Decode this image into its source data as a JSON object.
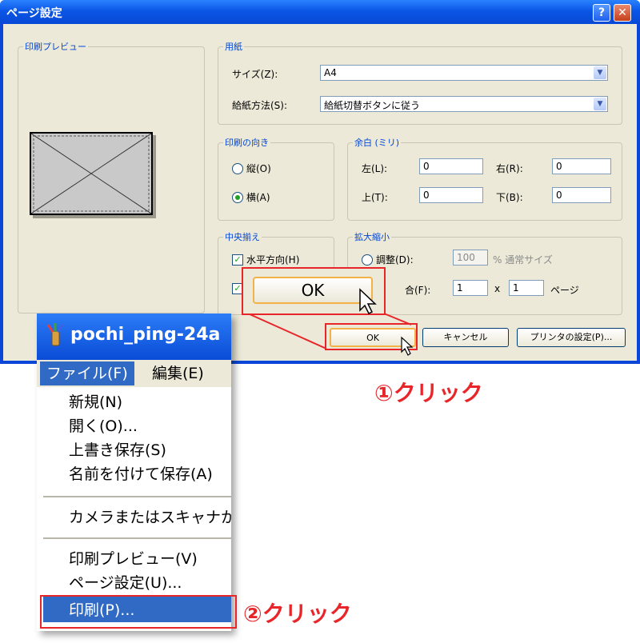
{
  "dialog": {
    "title": "ページ設定",
    "help_label": "?",
    "close_label": "✕",
    "preview_legend": "印刷プレビュー",
    "paper": {
      "legend": "用紙",
      "size_label": "サイズ(Z):",
      "size_value": "A4",
      "source_label": "給紙方法(S):",
      "source_value": "給紙切替ボタンに従う"
    },
    "orientation": {
      "legend": "印刷の向き",
      "portrait_label": "縦(O)",
      "landscape_label": "横(A)"
    },
    "margins": {
      "legend": "余白 (ミリ)",
      "left_label": "左(L):",
      "left_value": "0",
      "right_label": "右(R):",
      "right_value": "0",
      "top_label": "上(T):",
      "top_value": "0",
      "bottom_label": "下(B):",
      "bottom_value": "0"
    },
    "centering": {
      "legend": "中央揃え",
      "horizontal_label": "水平方向(H)"
    },
    "scaling": {
      "legend": "拡大縮小",
      "adjust_label": "調整(D):",
      "adjust_value": "100",
      "adjust_suffix": "% 通常サイズ",
      "fit_label": "合(F):",
      "fit_x_value": "1",
      "times": "x",
      "fit_y_value": "1",
      "pages_suffix": "ページ"
    },
    "ok_label": "OK",
    "cancel_label": "キャンセル",
    "printer_label": "プリンタの設定(P)..."
  },
  "zoom_ok_label": "OK",
  "app": {
    "title": "pochi_ping-24a",
    "menus": {
      "file": "ファイル(F)",
      "edit": "編集(E)"
    },
    "file_items": [
      "新規(N)",
      "開く(O)...",
      "上書き保存(S)",
      "名前を付けて保存(A)",
      "カメラまたはスキャナから",
      "印刷プレビュー(V)",
      "ページ設定(U)...",
      "印刷(P)..."
    ]
  },
  "annotations": {
    "step1": "①クリック",
    "step2": "②クリック"
  },
  "colors": {
    "title_blue": "#0a47d8",
    "highlight": "#316ac5",
    "annotation_red": "#e8262a",
    "face": "#ece9d8"
  }
}
